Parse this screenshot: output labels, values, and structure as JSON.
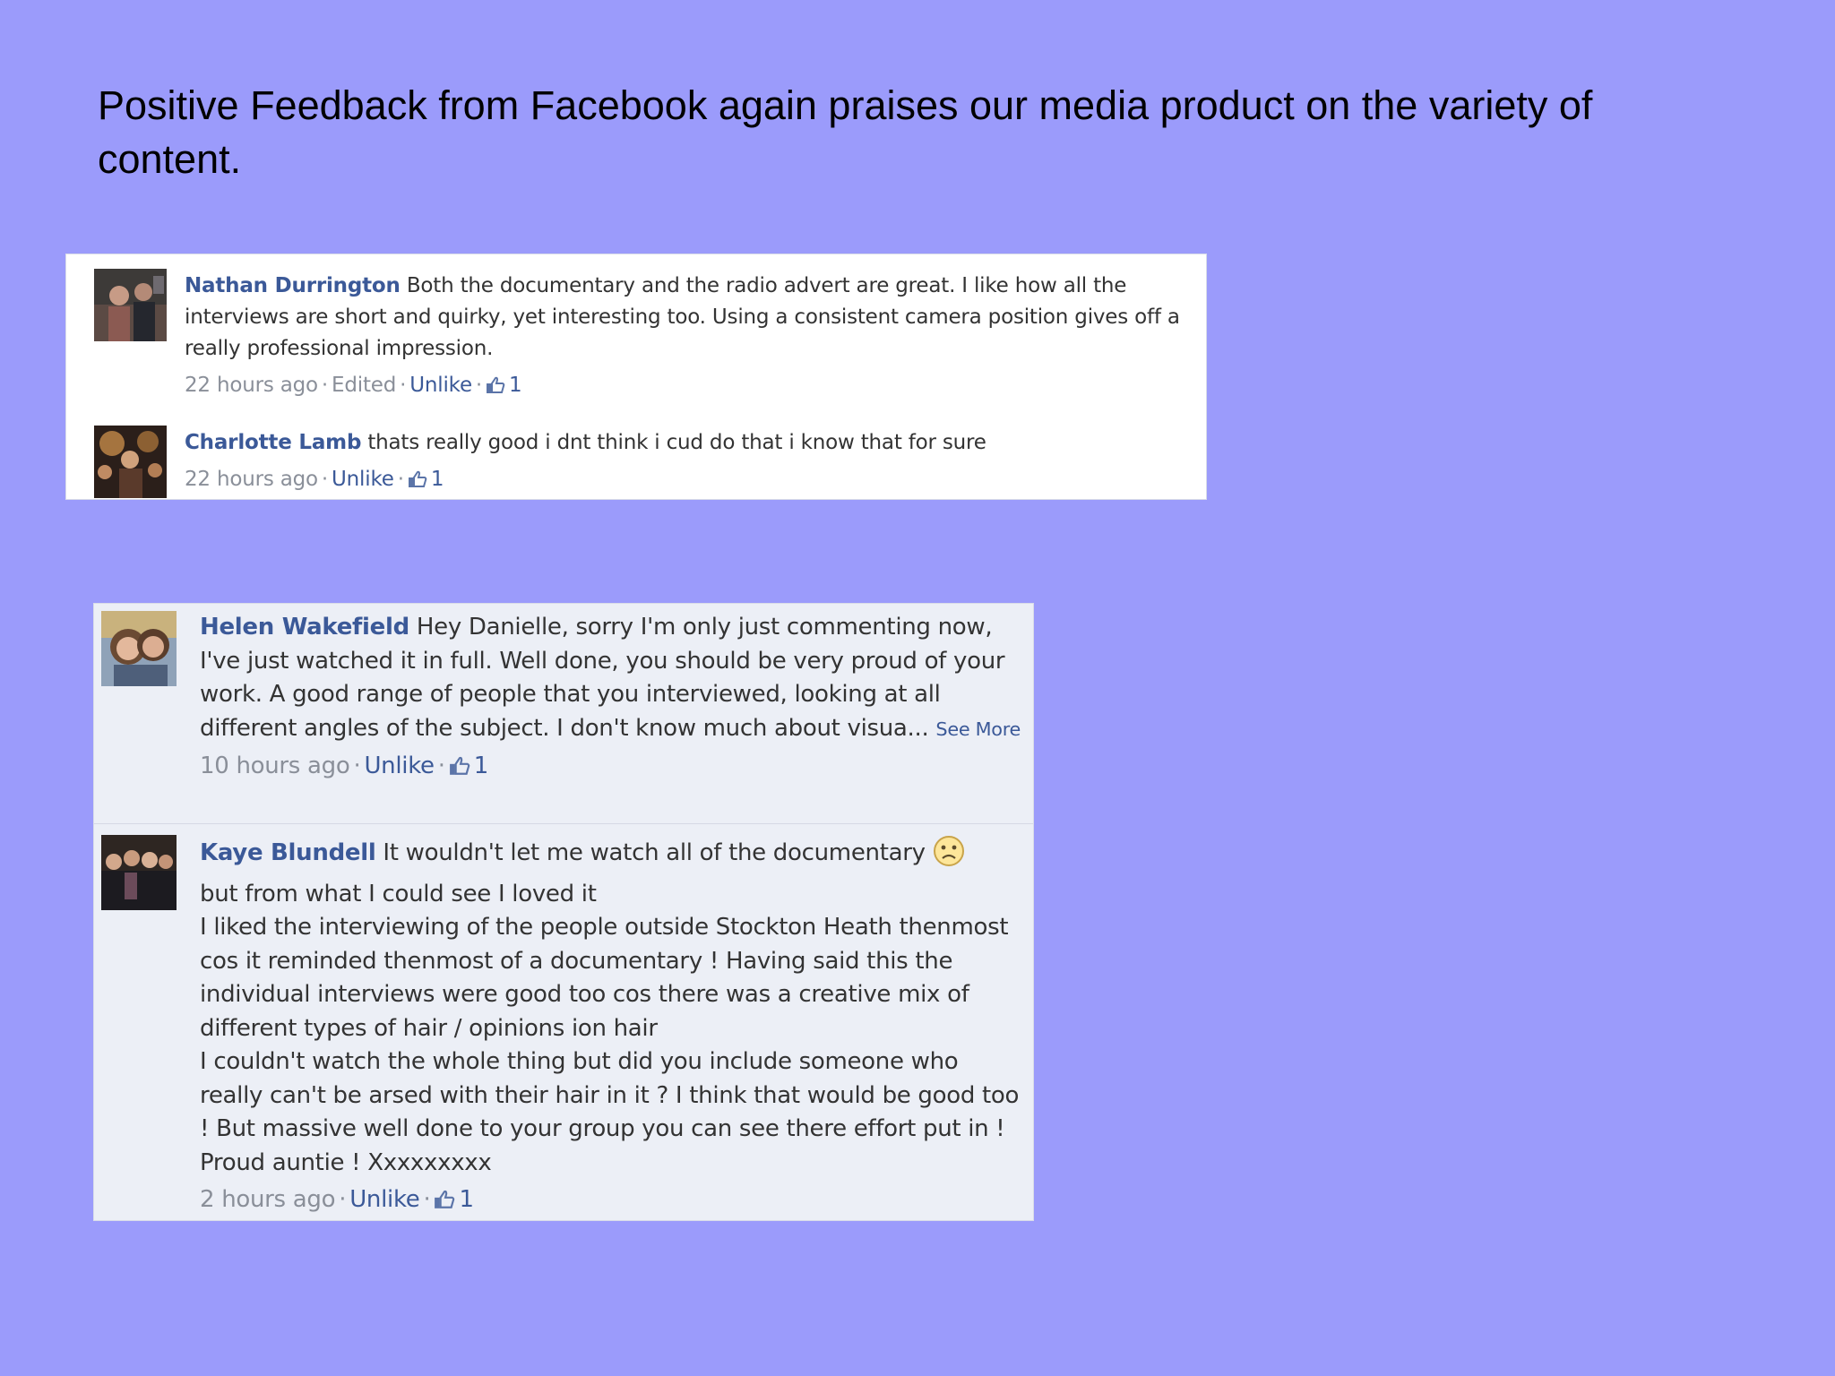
{
  "slide": {
    "title": "Positive Feedback from Facebook again praises our media product on the variety of content."
  },
  "colors": {
    "background": "#9b9bfb",
    "author_link": "#3b5998",
    "meta_text": "#8a8f99"
  },
  "panel1": {
    "comments": [
      {
        "author": "Nathan Durrington",
        "text": "Both the documentary and the radio advert are great. I like how all the interviews are short and quirky, yet interesting too. Using a consistent camera position gives off a really professional impression.",
        "time": "22 hours ago",
        "edited": "Edited",
        "action": "Unlike",
        "likes": "1",
        "avatar_icon": "profile-photo"
      },
      {
        "author": "Charlotte Lamb",
        "text": "thats really good i dnt think i cud do that i know that for sure",
        "time": "22 hours ago",
        "action": "Unlike",
        "likes": "1",
        "avatar_icon": "profile-photo"
      }
    ]
  },
  "panel2": {
    "comments": [
      {
        "author": "Helen Wakefield",
        "text": "Hey Danielle, sorry I'm only just commenting now, I've just watched it in full. Well done, you should be very proud of your work. A good range of people that you interviewed, looking at all different angles of the subject. I don't know much about visua...",
        "see_more": "See More",
        "time": "10 hours ago",
        "action": "Unlike",
        "likes": "1",
        "avatar_icon": "profile-photo"
      },
      {
        "author": "Kaye Blundell",
        "text_first": "It wouldn't let me watch all of the documentary",
        "emoji_icon": "sad-face-emoji",
        "text_rest": "but from what I could see I loved it\nI liked the interviewing of the people outside Stockton Heath thenmost cos it reminded thenmost of a documentary ! Having said this the individual interviews were good too cos there was a creative mix of different types of hair / opinions ion hair\nI couldn't watch the whole thing but did you include someone who really can't be arsed with their hair in it ? I think that would be good too ! But massive well done to your group you can see there effort put in ! Proud auntie ! Xxxxxxxxx",
        "time": "2 hours ago",
        "action": "Unlike",
        "likes": "1",
        "avatar_icon": "profile-photo"
      }
    ]
  }
}
